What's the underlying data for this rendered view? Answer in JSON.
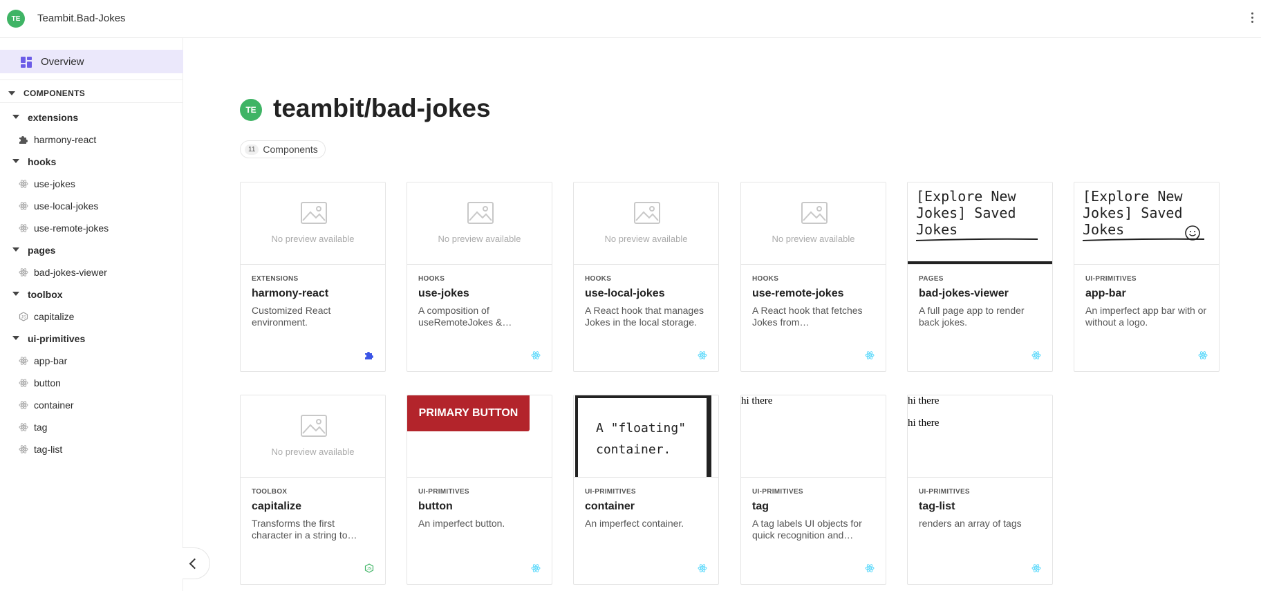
{
  "topbar": {
    "avatar_initials": "TE",
    "scope_name": "Teambit.Bad-Jokes",
    "menu_icon": "more-vertical-icon"
  },
  "sidebar": {
    "overview_label": "Overview",
    "section_label": "COMPONENTS",
    "namespaces": [
      {
        "name": "extensions",
        "items": [
          {
            "label": "harmony-react",
            "icon": "puzzle-icon"
          }
        ]
      },
      {
        "name": "hooks",
        "items": [
          {
            "label": "use-jokes",
            "icon": "react-icon"
          },
          {
            "label": "use-local-jokes",
            "icon": "react-icon"
          },
          {
            "label": "use-remote-jokes",
            "icon": "react-icon"
          }
        ]
      },
      {
        "name": "pages",
        "items": [
          {
            "label": "bad-jokes-viewer",
            "icon": "react-icon"
          }
        ]
      },
      {
        "name": "toolbox",
        "items": [
          {
            "label": "capitalize",
            "icon": "node-icon"
          }
        ]
      },
      {
        "name": "ui-primitives",
        "items": [
          {
            "label": "app-bar",
            "icon": "react-icon"
          },
          {
            "label": "button",
            "icon": "react-icon"
          },
          {
            "label": "container",
            "icon": "react-icon"
          },
          {
            "label": "tag",
            "icon": "react-icon"
          },
          {
            "label": "tag-list",
            "icon": "react-icon"
          }
        ]
      }
    ]
  },
  "main": {
    "avatar_initials": "TE",
    "title": "teambit/bad-jokes",
    "count": "11",
    "count_label": "Components",
    "no_preview_text": "No preview available",
    "cards": [
      {
        "namespace": "EXTENSIONS",
        "name": "harmony-react",
        "desc": "Customized React environment.",
        "preview": "none",
        "env_icon": "puzzle-icon"
      },
      {
        "namespace": "HOOKS",
        "name": "use-jokes",
        "desc": "A composition of useRemoteJokes &…",
        "preview": "none",
        "env_icon": "react-icon"
      },
      {
        "namespace": "HOOKS",
        "name": "use-local-jokes",
        "desc": "A React hook that manages Jokes in the local storage.",
        "preview": "none",
        "env_icon": "react-icon"
      },
      {
        "namespace": "HOOKS",
        "name": "use-remote-jokes",
        "desc": "A React hook that fetches Jokes from…",
        "preview": "none",
        "env_icon": "react-icon"
      },
      {
        "namespace": "PAGES",
        "name": "bad-jokes-viewer",
        "desc": "A full page app to render back jokes.",
        "preview": "appbar",
        "env_icon": "react-icon"
      },
      {
        "namespace": "UI-PRIMITIVES",
        "name": "app-bar",
        "desc": "An imperfect app bar with or without a logo.",
        "preview": "appbar-logo",
        "env_icon": "react-icon"
      },
      {
        "namespace": "TOOLBOX",
        "name": "capitalize",
        "desc": "Transforms the first character in a string to…",
        "preview": "none",
        "env_icon": "node-icon"
      },
      {
        "namespace": "UI-PRIMITIVES",
        "name": "button",
        "desc": "An imperfect button.",
        "preview": "button",
        "env_icon": "react-icon"
      },
      {
        "namespace": "UI-PRIMITIVES",
        "name": "container",
        "desc": "An imperfect container.",
        "preview": "container",
        "env_icon": "react-icon"
      },
      {
        "namespace": "UI-PRIMITIVES",
        "name": "tag",
        "desc": "A tag labels UI objects for quick recognition and…",
        "preview": "tag",
        "env_icon": "react-icon"
      },
      {
        "namespace": "UI-PRIMITIVES",
        "name": "tag-list",
        "desc": "renders an array of tags",
        "preview": "taglist",
        "env_icon": "react-icon"
      }
    ],
    "previews": {
      "appbar_line1": "[Explore New",
      "appbar_line2": "Jokes]   Saved",
      "appbar_line3": "Jokes",
      "button_label": "PRIMARY BUTTON",
      "container_line1": "A \"floating\"",
      "container_line2": "container.",
      "tag_text": "hi there",
      "taglist_text1": "hi there",
      "taglist_text2": "hi there"
    }
  },
  "colors": {
    "accent": "#6c5ce7",
    "overview_bg": "#ebe8fb",
    "avatar": "#3fb465",
    "primary_button": "#b3242b",
    "react": "#61dafb",
    "node": "#3fb465"
  }
}
